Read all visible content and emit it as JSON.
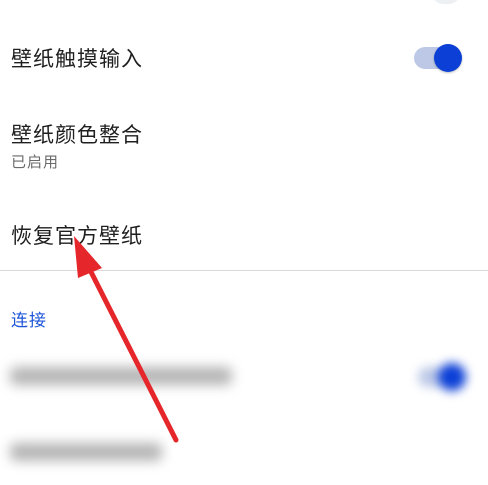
{
  "settings": {
    "wallpaper_touch_input": {
      "title": "壁纸触摸输入",
      "toggle_on": true
    },
    "wallpaper_color_integration": {
      "title": "壁纸颜色整合",
      "subtitle": "已启用"
    },
    "restore_official_wallpaper": {
      "title": "恢复官方壁纸"
    }
  },
  "section": {
    "header": "连接"
  },
  "colors": {
    "accent": "#0b3fd6",
    "section_header": "#1e56d9",
    "annotation_arrow": "#e5262a"
  },
  "icons": {
    "annotation": "red-arrow-icon"
  }
}
